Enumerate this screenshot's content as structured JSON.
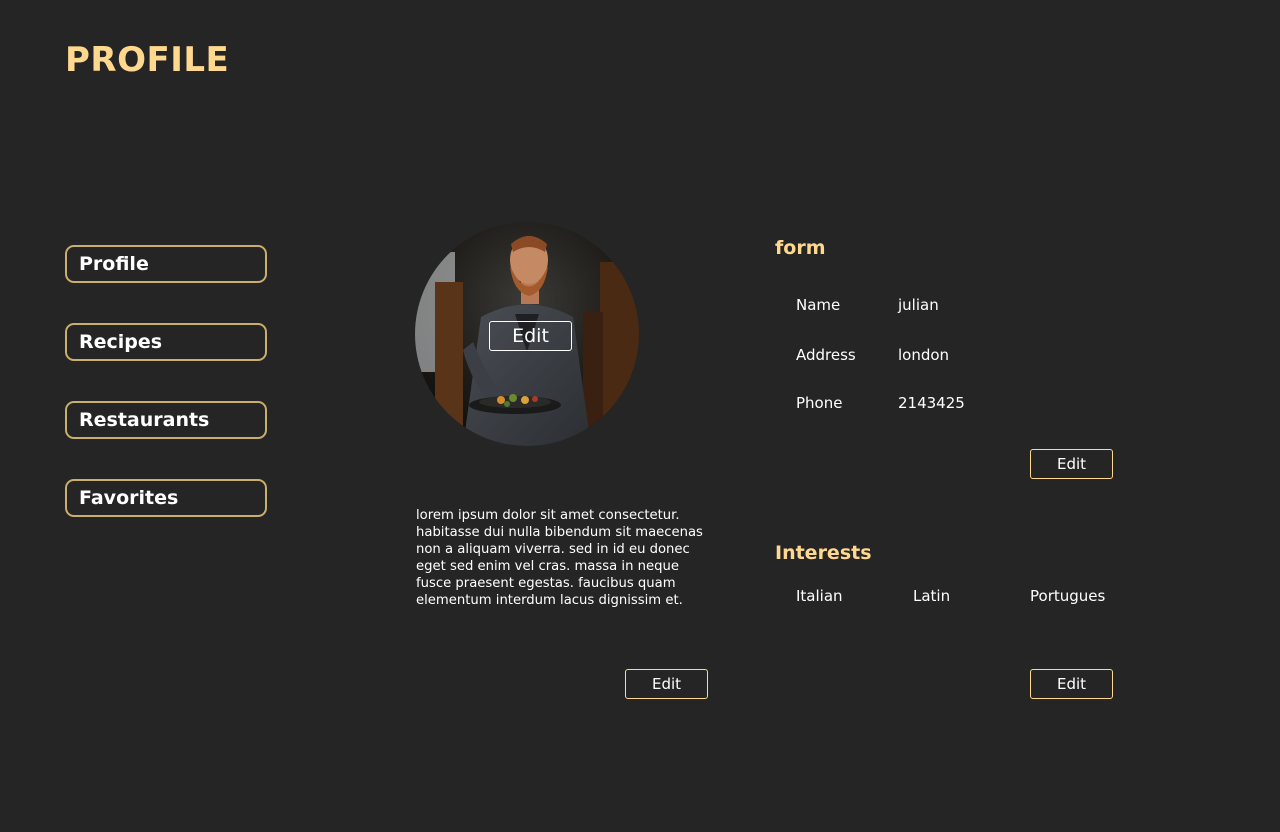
{
  "header": {
    "title": "PROFILE"
  },
  "sidebar": {
    "items": [
      {
        "label": "Profile"
      },
      {
        "label": "Recipes"
      },
      {
        "label": "Restaurants"
      },
      {
        "label": "Favorites"
      }
    ]
  },
  "profile": {
    "photo_edit_label": "Edit",
    "bio": "lorem ipsum dolor sit amet consectetur. habitasse dui nulla bibendum sit maecenas non a aliquam viverra. sed in id eu donec eget sed enim vel cras. massa in neque fusce praesent egestas. faucibus quam elementum interdum lacus dignissim et.",
    "bio_edit_label": "Edit"
  },
  "form": {
    "title": "form",
    "fields": [
      {
        "label": "Name",
        "value": "julian"
      },
      {
        "label": "Address",
        "value": "london"
      },
      {
        "label": "Phone",
        "value": "2143425"
      }
    ],
    "edit_label": "Edit"
  },
  "interests": {
    "title": "Interests",
    "items": [
      "Italian",
      "Latin",
      "Portugues"
    ],
    "edit_label": "Edit"
  },
  "colors": {
    "background": "#252525",
    "accent": "#ffd88f",
    "nav_border": "#c9ae6c",
    "text": "#ffffff"
  }
}
